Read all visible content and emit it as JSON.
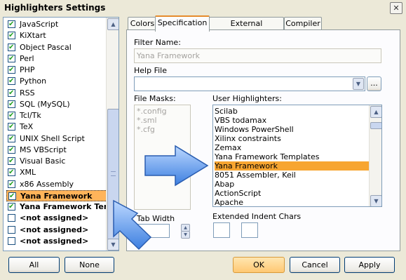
{
  "window": {
    "title": "Highlighters Settings",
    "close_glyph": "✕"
  },
  "left_list": {
    "items": [
      {
        "label": "JavaScript",
        "checked": true
      },
      {
        "label": "KiXtart",
        "checked": true
      },
      {
        "label": "Object Pascal",
        "checked": true
      },
      {
        "label": "Perl",
        "checked": true
      },
      {
        "label": "PHP",
        "checked": true
      },
      {
        "label": "Python",
        "checked": true
      },
      {
        "label": "RSS",
        "checked": true
      },
      {
        "label": "SQL (MySQL)",
        "checked": true
      },
      {
        "label": "Tcl/Tk",
        "checked": true
      },
      {
        "label": "TeX",
        "checked": true
      },
      {
        "label": "UNIX Shell Script",
        "checked": true
      },
      {
        "label": "MS VBScript",
        "checked": true
      },
      {
        "label": "Visual Basic",
        "checked": true
      },
      {
        "label": "XML",
        "checked": true
      },
      {
        "label": "x86 Assembly",
        "checked": true
      },
      {
        "label": "Yana Framework",
        "checked": true,
        "selected": true,
        "bold": true
      },
      {
        "label": "Yana Framework Templates",
        "checked": true,
        "bold": true
      },
      {
        "label": "<not assigned>",
        "checked": false,
        "bold": true
      },
      {
        "label": "<not assigned>",
        "checked": false,
        "bold": true
      },
      {
        "label": "<not assigned>",
        "checked": false,
        "bold": true
      }
    ]
  },
  "tabs": [
    {
      "label": "Colors",
      "active": false
    },
    {
      "label": "Specification",
      "active": true
    },
    {
      "label": "External applications",
      "active": false
    },
    {
      "label": "Compiler",
      "active": false
    }
  ],
  "spec": {
    "filter_name_label": "Filter Name:",
    "filter_name_value": "Yana Framework",
    "help_file_label": "Help File",
    "help_file_value": "",
    "browse_label": "...",
    "file_masks_label": "File Masks:",
    "file_masks": [
      "*.config",
      "*.sml",
      "*.cfg"
    ],
    "user_highlighters_label": "User Highlighters:",
    "user_highlighters": [
      "Scilab",
      "VBS todamax",
      "Windows PowerShell",
      "Xilinx constraints",
      "Zemax",
      "Yana Framework Templates",
      "Yana Framework",
      "8051 Assembler, Keil",
      "Abap",
      "ActionScript",
      "Apache"
    ],
    "user_highlighters_selected": "Yana Framework",
    "tab_width_label": "Tab Width",
    "tab_width_value": "",
    "extended_indent_label": "Extended Indent Chars",
    "indent_char_1": "",
    "indent_char_2": ""
  },
  "footer": {
    "all_label": "All",
    "none_label": "None",
    "ok_label": "OK",
    "cancel_label": "Cancel",
    "apply_label": "Apply"
  },
  "colors": {
    "accent": "#ffb45a",
    "arrow": "#5b9bf0"
  }
}
